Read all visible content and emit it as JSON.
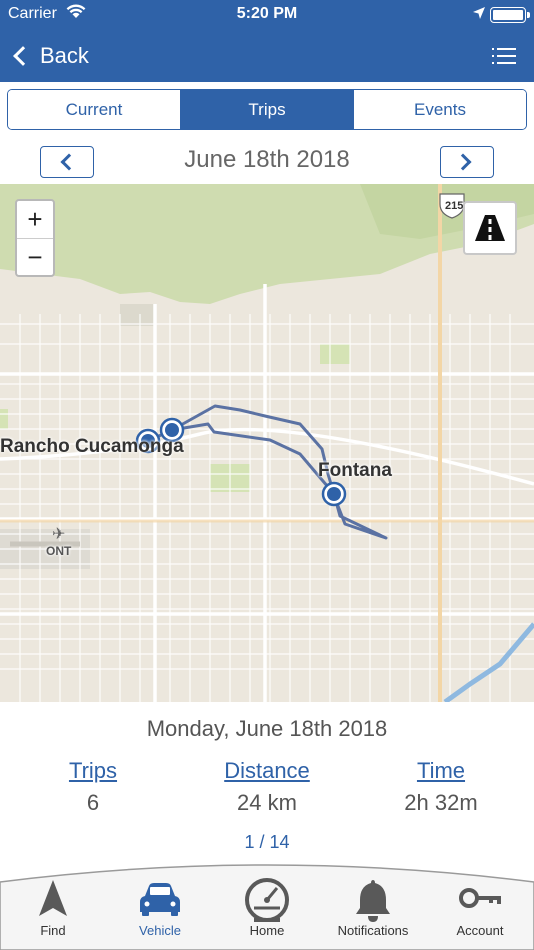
{
  "status_bar": {
    "carrier": "Carrier",
    "time": "5:20 PM"
  },
  "nav": {
    "back_label": "Back"
  },
  "segments": [
    {
      "label": "Current",
      "active": false
    },
    {
      "label": "Trips",
      "active": true
    },
    {
      "label": "Events",
      "active": false
    }
  ],
  "date_nav": {
    "date": "June 18th 2018"
  },
  "map": {
    "zoom_in": "+",
    "zoom_out": "−",
    "labels": {
      "city1": "Rancho Cucamonga",
      "city2": "Fontana",
      "airport": "ONT",
      "highway": "215"
    },
    "route_color": "#5b72a3",
    "marker_color": "#2f62a8"
  },
  "summary": {
    "day": "Monday, June 18th 2018",
    "stats": [
      {
        "label": "Trips",
        "value": "6"
      },
      {
        "label": "Distance",
        "value": "24 km"
      },
      {
        "label": "Time",
        "value": "2h 32m"
      }
    ],
    "pager": "1 / 14"
  },
  "tabs": [
    {
      "label": "Find",
      "icon": "navigation-arrow-icon",
      "active": false
    },
    {
      "label": "Vehicle",
      "icon": "car-icon",
      "active": true
    },
    {
      "label": "Home",
      "icon": "speedometer-icon",
      "active": false
    },
    {
      "label": "Notifications",
      "icon": "bell-icon",
      "active": false
    },
    {
      "label": "Account",
      "icon": "key-icon",
      "active": false
    }
  ],
  "colors": {
    "brand": "#2f62a8",
    "tab_active": "#2f62a8",
    "tab_inactive": "#595959"
  }
}
